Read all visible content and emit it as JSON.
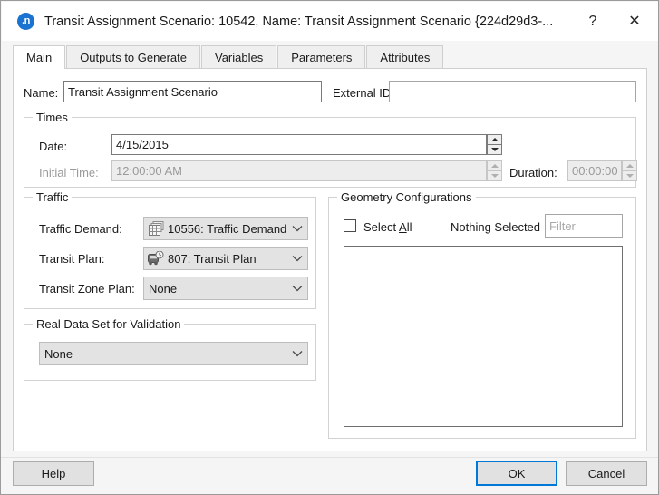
{
  "window": {
    "icon_name": "app-icon-n",
    "icon_text": ".n",
    "title": "Transit Assignment Scenario: 10542, Name: Transit Assignment Scenario  {224d29d3-...",
    "help_glyph": "?",
    "close_glyph": "✕",
    "accent_color": "#0078d7",
    "icon_color": "#1a73d0"
  },
  "tabs": [
    {
      "label": "Main",
      "active": true
    },
    {
      "label": "Outputs to Generate",
      "active": false
    },
    {
      "label": "Variables",
      "active": false
    },
    {
      "label": "Parameters",
      "active": false
    },
    {
      "label": "Attributes",
      "active": false
    }
  ],
  "main": {
    "name_label": "Name:",
    "name_value": "Transit Assignment Scenario",
    "external_id_label": "External ID:",
    "external_id_value": "",
    "times": {
      "title": "Times",
      "date_label": "Date:",
      "date_value": "4/15/2015",
      "initial_time_label": "Initial Time:",
      "initial_time_value": "12:00:00 AM",
      "duration_label": "Duration:",
      "duration_value": "00:00:00"
    },
    "traffic": {
      "title": "Traffic",
      "traffic_demand_label": "Traffic Demand:",
      "traffic_demand_value": "10556: Traffic Demand",
      "traffic_demand_icon": "matrix-stack-icon",
      "transit_plan_label": "Transit Plan:",
      "transit_plan_value": "807: Transit Plan",
      "transit_plan_icon": "bus-clock-icon",
      "transit_zone_plan_label": "Transit Zone Plan:",
      "transit_zone_plan_value": "None"
    },
    "real_data_set": {
      "title": "Real Data Set for Validation",
      "value": "None"
    },
    "geometry": {
      "title": "Geometry Configurations",
      "select_all_prefix": "Select ",
      "select_all_mnemonic": "A",
      "select_all_suffix": "ll",
      "selection_status": "Nothing Selected",
      "filter_placeholder": "Filter",
      "filter_value": "",
      "items": []
    }
  },
  "footer": {
    "help_label": "Help",
    "ok_label": "OK",
    "cancel_label": "Cancel"
  }
}
